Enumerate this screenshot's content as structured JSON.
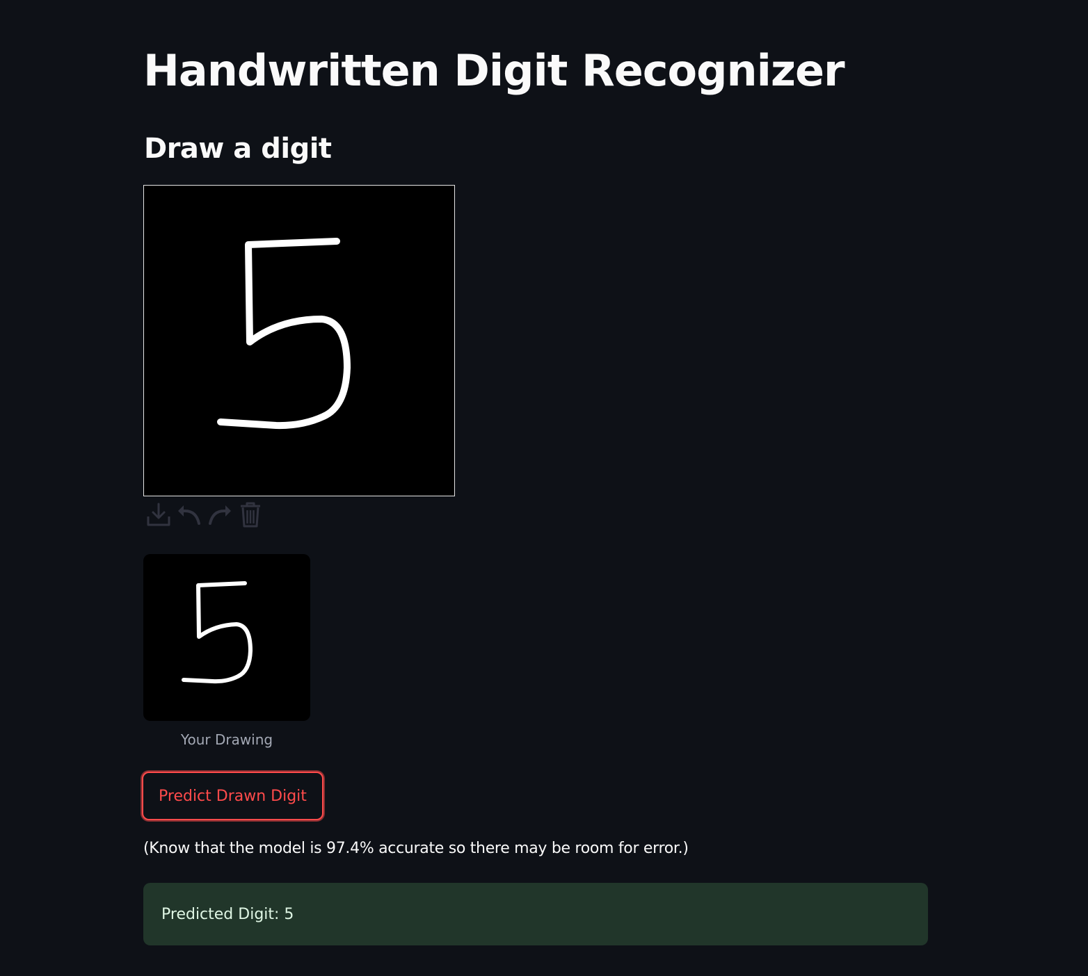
{
  "page": {
    "title": "Handwritten Digit Recognizer",
    "subheader": "Draw a digit"
  },
  "canvas": {
    "toolbar": [
      {
        "name": "download-icon"
      },
      {
        "name": "undo-icon"
      },
      {
        "name": "redo-icon"
      },
      {
        "name": "trash-icon"
      }
    ]
  },
  "preview": {
    "caption": "Your Drawing"
  },
  "actions": {
    "predict_label": "Predict Drawn Digit"
  },
  "info": {
    "accuracy_note": "(Know that the model is 97.4% accurate so there may be room for error.)"
  },
  "result": {
    "text": "Predicted Digit: 5"
  },
  "colors": {
    "background": "#0e1117",
    "accent": "#ff4b4b",
    "success_bg": "#21362a",
    "success_text": "#dff6e4"
  }
}
